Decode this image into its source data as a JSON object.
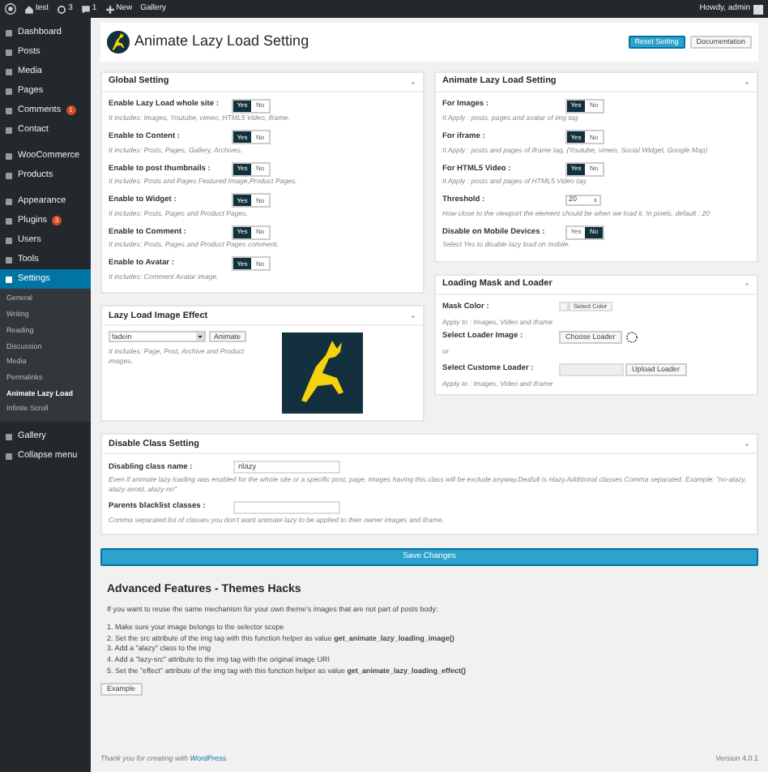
{
  "admin_bar": {
    "site": "test",
    "updates": "3",
    "comments": "1",
    "new": "New",
    "gallery": "Gallery",
    "greeting": "Howdy, admin"
  },
  "sidebar": {
    "items": [
      {
        "label": "Dashboard",
        "selected": false
      },
      {
        "label": "Posts",
        "selected": false
      },
      {
        "label": "Media",
        "selected": false
      },
      {
        "label": "Pages",
        "selected": false
      },
      {
        "label": "Comments",
        "selected": false,
        "badge": "1"
      },
      {
        "label": "Contact",
        "selected": false
      },
      {
        "label": "WooCommerce",
        "selected": false
      },
      {
        "label": "Products",
        "selected": false
      },
      {
        "label": "Appearance",
        "selected": false
      },
      {
        "label": "Plugins",
        "selected": false,
        "badge": "3"
      },
      {
        "label": "Users",
        "selected": false
      },
      {
        "label": "Tools",
        "selected": false
      },
      {
        "label": "Settings",
        "selected": true,
        "children": [
          {
            "label": "General",
            "selected": false
          },
          {
            "label": "Writing",
            "selected": false
          },
          {
            "label": "Reading",
            "selected": false
          },
          {
            "label": "Discussion",
            "selected": false
          },
          {
            "label": "Media",
            "selected": false
          },
          {
            "label": "Permalinks",
            "selected": false
          },
          {
            "label": "Animate Lazy Load",
            "selected": true
          },
          {
            "label": "Infinite Scroll",
            "selected": false
          }
        ]
      },
      {
        "label": "Gallery",
        "selected": false
      },
      {
        "label": "Collapse menu",
        "selected": false
      }
    ]
  },
  "header": {
    "title": "Animate Lazy Load Setting",
    "buttons": [
      {
        "label": "Reset Setting",
        "primary": true
      },
      {
        "label": "Documentation",
        "primary": false
      }
    ]
  },
  "global_setting": {
    "title": "Global Setting",
    "rows": [
      {
        "kind": "toggle",
        "label": "Enable Lazy Load whole site :",
        "options": [
          {
            "label": "Yes",
            "selected": true
          },
          {
            "label": "No",
            "selected": false
          }
        ],
        "description": "It includes: Images, Youtube, vimeo, HTML5 Video, iframe."
      },
      {
        "kind": "toggle",
        "label": "Enable to Content :",
        "options": [
          {
            "label": "Yes",
            "selected": true
          },
          {
            "label": "No",
            "selected": false
          }
        ],
        "description": "It includes: Posts, Pages, Gallery, Archives."
      },
      {
        "kind": "toggle",
        "label": "Enable to post thumbnails :",
        "options": [
          {
            "label": "Yes",
            "selected": true
          },
          {
            "label": "No",
            "selected": false
          }
        ],
        "description": "It includes: Posts and Pages Featured Image,Product Pages."
      },
      {
        "kind": "toggle",
        "label": "Enable to Widget :",
        "options": [
          {
            "label": "Yes",
            "selected": true
          },
          {
            "label": "No",
            "selected": false
          }
        ],
        "description": "It includes: Posts, Pages and Product Pages."
      },
      {
        "kind": "toggle",
        "label": "Enable to Comment :",
        "options": [
          {
            "label": "Yes",
            "selected": true
          },
          {
            "label": "No",
            "selected": false
          }
        ],
        "description": "It includes: Posts, Pages and Product Pages comment."
      },
      {
        "kind": "toggle",
        "label": "Enable to Avatar :",
        "options": [
          {
            "label": "Yes",
            "selected": true
          },
          {
            "label": "No",
            "selected": false
          }
        ],
        "description": "It includes: Comment Avatar image."
      }
    ]
  },
  "animate_setting": {
    "title": "Animate Lazy Load Setting",
    "rows": [
      {
        "kind": "toggle",
        "label": "For Images :",
        "options": [
          {
            "label": "Yes",
            "selected": true
          },
          {
            "label": "No",
            "selected": false
          }
        ],
        "description": "It Apply : posts, pages and avatar of img tag"
      },
      {
        "kind": "toggle",
        "label": "For iframe :",
        "options": [
          {
            "label": "Yes",
            "selected": true
          },
          {
            "label": "No",
            "selected": false
          }
        ],
        "description": "It Apply : posts and pages of iframe tag. (Youtube, vimeo, Social Widget, Google Map)"
      },
      {
        "kind": "toggle",
        "label": "For HTML5 Video :",
        "options": [
          {
            "label": "Yes",
            "selected": true
          },
          {
            "label": "No",
            "selected": false
          }
        ],
        "description": "It Apply : posts and pages of HTML5 Video tag"
      },
      {
        "kind": "number",
        "label": "Threshold :",
        "value": "20",
        "description": "How close to the viewport the element should be when we load it. In pixels. default : 20"
      },
      {
        "kind": "toggle",
        "label": "Disable on Mobile Devices :",
        "options": [
          {
            "label": "Yes",
            "selected": false
          },
          {
            "label": "No",
            "selected": true
          }
        ],
        "description": "Select Yes to disable lazy load on mobile."
      }
    ]
  },
  "image_effect": {
    "title": "Lazy Load Image Effect",
    "select_value": "fadein",
    "button": "Animate",
    "description": "It includes: Page, Post, Archive and Product images."
  },
  "loading_mask": {
    "title": "Loading Mask and Loader",
    "mask_label": "Mask Color :",
    "mask_button": "Select Color",
    "mask_note": "Apply to : Images, Video and iframe",
    "loader_label": "Select Loader Image :",
    "loader_button": "Choose Loader",
    "or": "or",
    "custom_label": "Select Custome Loader :",
    "custom_button": "Upload Loader",
    "custom_note": "Apply to : Images, Video and iframe"
  },
  "disable_class": {
    "title": "Disable Class Setting",
    "rows": [
      {
        "label": "Disabling class name :",
        "value": "nlazy",
        "description": "Even if animate lazy loading was enabled for the whole site or a specific post, page, images having this class will be exclude anyway.Deafult is nlazy.Additional classes Comma separated. Example: \"no-alazy, alazy-avoid, alazy-no\""
      },
      {
        "label": "Parents blacklist classes :",
        "description": "Comma separated list of classes you don't want animate lazy to be applied to thier owner images and iframe."
      }
    ]
  },
  "save_button": "Save Changes",
  "advanced": {
    "title": "Advanced Features - Themes Hacks",
    "intro": "If you want to reuse the same mechanism for your own theme's images that are not part of posts body:",
    "steps": [
      "1. Make sure your image belongs to the selector scope",
      "2. Set the src attribute of the img tag with this function helper as value **get_animate_lazy_loading_image()**",
      "3. Add a \"alazy\" class to the img",
      "4. Add a \"lazy-src\" attribute to the img tag with the original image URI",
      "5. Set the \"effect\" attribute of the img tag with this function helper as value **get_animate_lazy_loading_effect()**"
    ],
    "button": "Example"
  },
  "footer": {
    "thanks": "Thank you for creating with",
    "link": "WordPress",
    "end": ".",
    "version": "Version 4.0.1"
  }
}
